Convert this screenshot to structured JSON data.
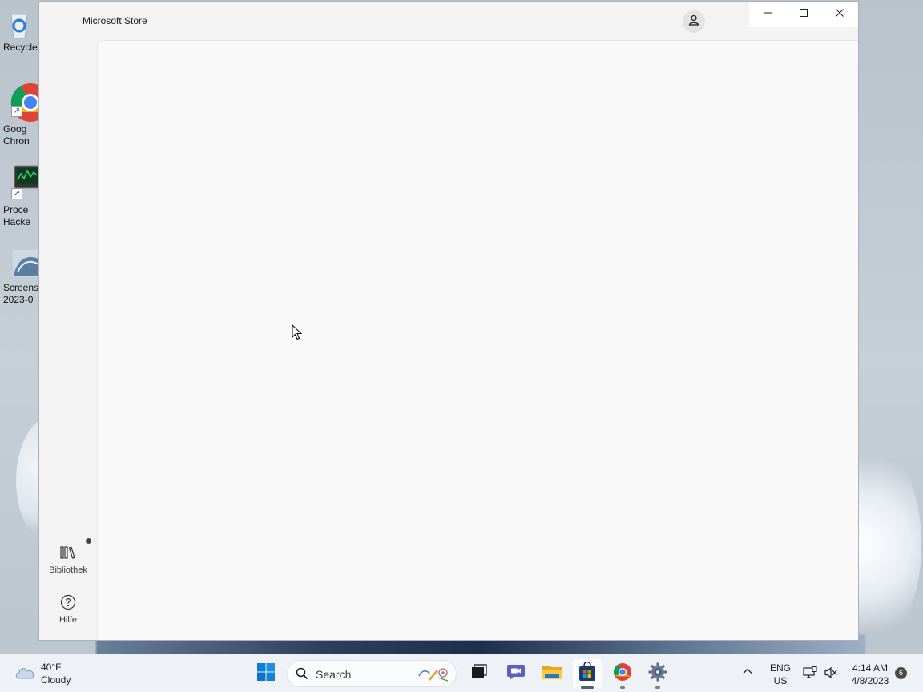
{
  "desktop": {
    "icons": [
      {
        "label": "Recycle",
        "icon": "recycle-bin-icon"
      },
      {
        "label": "Goog\nChron",
        "icon": "chrome-icon"
      },
      {
        "label": "Proce\nHacke",
        "icon": "process-hacker-icon"
      },
      {
        "label": "Screens\n2023-0",
        "icon": "image-file-icon"
      }
    ]
  },
  "window": {
    "title": "Microsoft Store",
    "caption_buttons": [
      "minimize",
      "maximize",
      "close"
    ],
    "account_icon": "person-icon",
    "nav": {
      "library_label": "Bibliothek",
      "library_icon": "library-icon",
      "help_label": "Hilfe",
      "help_icon": "help-circle-icon"
    }
  },
  "taskbar": {
    "weather": {
      "temp": "40°F",
      "condition": "Cloudy",
      "icon": "cloud-icon"
    },
    "search": {
      "label": "Search"
    },
    "apps": [
      {
        "name": "start",
        "icon": "windows-start-icon"
      },
      {
        "name": "task-view",
        "icon": "task-view-icon"
      },
      {
        "name": "teams-chat",
        "icon": "chat-icon"
      },
      {
        "name": "file-explorer",
        "icon": "folder-icon"
      },
      {
        "name": "microsoft-store",
        "icon": "store-icon",
        "active": true
      },
      {
        "name": "chrome",
        "icon": "chrome-icon"
      },
      {
        "name": "settings",
        "icon": "gear-icon"
      }
    ],
    "tray": {
      "lang_line1": "ENG",
      "lang_line2": "US",
      "time": "4:14 AM",
      "date": "4/8/2023",
      "notification_count": "6"
    }
  },
  "colors": {
    "accent": "#0067c0",
    "window_bg": "#f3f3f3",
    "content_bg": "#f9f9f9",
    "taskbar_bg": "#eef1f5"
  }
}
